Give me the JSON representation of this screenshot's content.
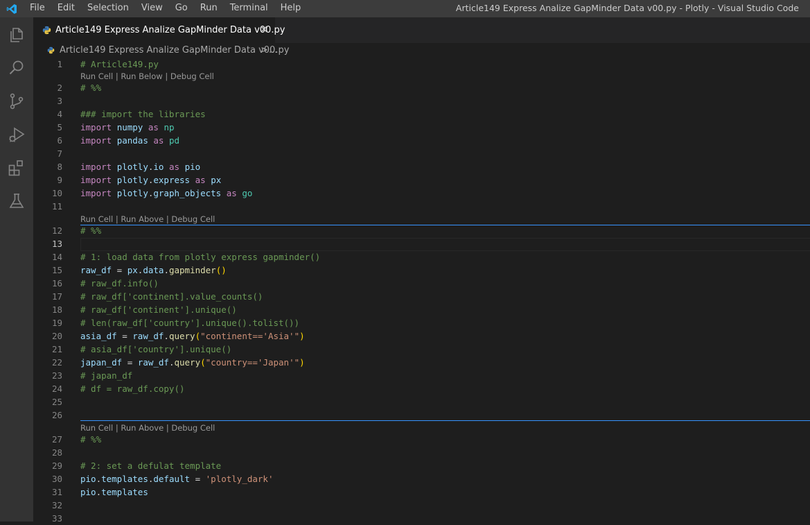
{
  "titlebar": {
    "menu": [
      "File",
      "Edit",
      "Selection",
      "View",
      "Go",
      "Run",
      "Terminal",
      "Help"
    ],
    "window_title": "Article149 Express Analize GapMinder Data v00.py - Plotly - Visual Studio Code"
  },
  "activity_bar": {
    "icons": [
      "explorer-icon",
      "search-icon",
      "source-control-icon",
      "run-debug-icon",
      "extensions-icon",
      "testing-icon"
    ]
  },
  "tab": {
    "label": "Article149 Express Analize GapMinder Data v00.py",
    "close_icon": "close-icon"
  },
  "breadcrumb": {
    "file": "Article149 Express Analize GapMinder Data v00.py",
    "separator": ">",
    "more": "..."
  },
  "codelens": {
    "first": "Run Cell | Run Below | Debug Cell",
    "second": "Run Cell | Run Above | Debug Cell",
    "third": "Run Cell | Run Above | Debug Cell"
  },
  "lines": [
    {
      "n": "1",
      "tokens": [
        [
          "cmt",
          "# Article149.py"
        ]
      ]
    },
    {
      "n": "2",
      "tokens": [
        [
          "cmt",
          "# %%"
        ]
      ]
    },
    {
      "n": "3",
      "tokens": []
    },
    {
      "n": "4",
      "tokens": [
        [
          "cmt",
          "### import the libraries"
        ]
      ]
    },
    {
      "n": "5",
      "tokens": [
        [
          "kw",
          "import"
        ],
        [
          "op",
          " "
        ],
        [
          "id",
          "numpy"
        ],
        [
          "op",
          " "
        ],
        [
          "kw",
          "as"
        ],
        [
          "op",
          " "
        ],
        [
          "mod",
          "np"
        ]
      ]
    },
    {
      "n": "6",
      "tokens": [
        [
          "kw",
          "import"
        ],
        [
          "op",
          " "
        ],
        [
          "id",
          "pandas"
        ],
        [
          "op",
          " "
        ],
        [
          "kw",
          "as"
        ],
        [
          "op",
          " "
        ],
        [
          "mod",
          "pd"
        ]
      ]
    },
    {
      "n": "7",
      "tokens": []
    },
    {
      "n": "8",
      "tokens": [
        [
          "kw",
          "import"
        ],
        [
          "op",
          " "
        ],
        [
          "id",
          "plotly"
        ],
        [
          "op",
          "."
        ],
        [
          "id",
          "io"
        ],
        [
          "op",
          " "
        ],
        [
          "kw",
          "as"
        ],
        [
          "op",
          " "
        ],
        [
          "id",
          "pio"
        ]
      ]
    },
    {
      "n": "9",
      "tokens": [
        [
          "kw",
          "import"
        ],
        [
          "op",
          " "
        ],
        [
          "id",
          "plotly"
        ],
        [
          "op",
          "."
        ],
        [
          "id",
          "express"
        ],
        [
          "op",
          " "
        ],
        [
          "kw",
          "as"
        ],
        [
          "op",
          " "
        ],
        [
          "id",
          "px"
        ]
      ]
    },
    {
      "n": "10",
      "tokens": [
        [
          "kw",
          "import"
        ],
        [
          "op",
          " "
        ],
        [
          "id",
          "plotly"
        ],
        [
          "op",
          "."
        ],
        [
          "id",
          "graph_objects"
        ],
        [
          "op",
          " "
        ],
        [
          "kw",
          "as"
        ],
        [
          "op",
          " "
        ],
        [
          "mod",
          "go"
        ]
      ]
    },
    {
      "n": "11",
      "tokens": []
    },
    {
      "n": "12",
      "tokens": [
        [
          "cmt",
          "# %%"
        ]
      ]
    },
    {
      "n": "13",
      "tokens": []
    },
    {
      "n": "14",
      "tokens": [
        [
          "cmt",
          "# 1: load data from plotly express gapminder()"
        ]
      ]
    },
    {
      "n": "15",
      "tokens": [
        [
          "id",
          "raw_df"
        ],
        [
          "op",
          " = "
        ],
        [
          "id",
          "px"
        ],
        [
          "op",
          "."
        ],
        [
          "id",
          "data"
        ],
        [
          "op",
          "."
        ],
        [
          "fn",
          "gapminder"
        ],
        [
          "paren",
          "()"
        ]
      ]
    },
    {
      "n": "16",
      "tokens": [
        [
          "cmt",
          "# raw_df.info()"
        ]
      ]
    },
    {
      "n": "17",
      "tokens": [
        [
          "cmt",
          "# raw_df['continent].value_counts()"
        ]
      ]
    },
    {
      "n": "18",
      "tokens": [
        [
          "cmt",
          "# raw_df['continent'].unique()"
        ]
      ]
    },
    {
      "n": "19",
      "tokens": [
        [
          "cmt",
          "# len(raw_df['country'].unique().tolist())"
        ]
      ]
    },
    {
      "n": "20",
      "tokens": [
        [
          "id",
          "asia_df"
        ],
        [
          "op",
          " = "
        ],
        [
          "id",
          "raw_df"
        ],
        [
          "op",
          "."
        ],
        [
          "fn",
          "query"
        ],
        [
          "paren",
          "("
        ],
        [
          "str",
          "\"continent=='Asia'\""
        ],
        [
          "paren",
          ")"
        ]
      ]
    },
    {
      "n": "21",
      "tokens": [
        [
          "cmt",
          "# asia_df['country'].unique()"
        ]
      ]
    },
    {
      "n": "22",
      "tokens": [
        [
          "id",
          "japan_df"
        ],
        [
          "op",
          " = "
        ],
        [
          "id",
          "raw_df"
        ],
        [
          "op",
          "."
        ],
        [
          "fn",
          "query"
        ],
        [
          "paren",
          "("
        ],
        [
          "str",
          "\"country=='Japan'\""
        ],
        [
          "paren",
          ")"
        ]
      ]
    },
    {
      "n": "23",
      "tokens": [
        [
          "cmt",
          "# japan_df"
        ]
      ]
    },
    {
      "n": "24",
      "tokens": [
        [
          "cmt",
          "# df = raw_df.copy()"
        ]
      ]
    },
    {
      "n": "25",
      "tokens": []
    },
    {
      "n": "26",
      "tokens": []
    },
    {
      "n": "27",
      "tokens": [
        [
          "cmt",
          "# %%"
        ]
      ]
    },
    {
      "n": "28",
      "tokens": []
    },
    {
      "n": "29",
      "tokens": [
        [
          "cmt",
          "# 2: set a defulat template"
        ]
      ]
    },
    {
      "n": "30",
      "tokens": [
        [
          "id",
          "pio"
        ],
        [
          "op",
          "."
        ],
        [
          "id",
          "templates"
        ],
        [
          "op",
          "."
        ],
        [
          "id",
          "default"
        ],
        [
          "op",
          " = "
        ],
        [
          "str",
          "'plotly_dark'"
        ]
      ]
    },
    {
      "n": "31",
      "tokens": [
        [
          "id",
          "pio"
        ],
        [
          "op",
          "."
        ],
        [
          "id",
          "templates"
        ]
      ]
    },
    {
      "n": "32",
      "tokens": []
    },
    {
      "n": "33",
      "tokens": []
    }
  ],
  "active_line": "13",
  "colors": {
    "titlebar_bg": "#3c3c3c",
    "activitybar_bg": "#333333",
    "editor_bg": "#1e1e1e",
    "cell_separator": "#3794ff",
    "keyword": "#c586c0",
    "comment": "#6a9955",
    "string": "#ce9178",
    "identifier": "#9cdcfe"
  }
}
